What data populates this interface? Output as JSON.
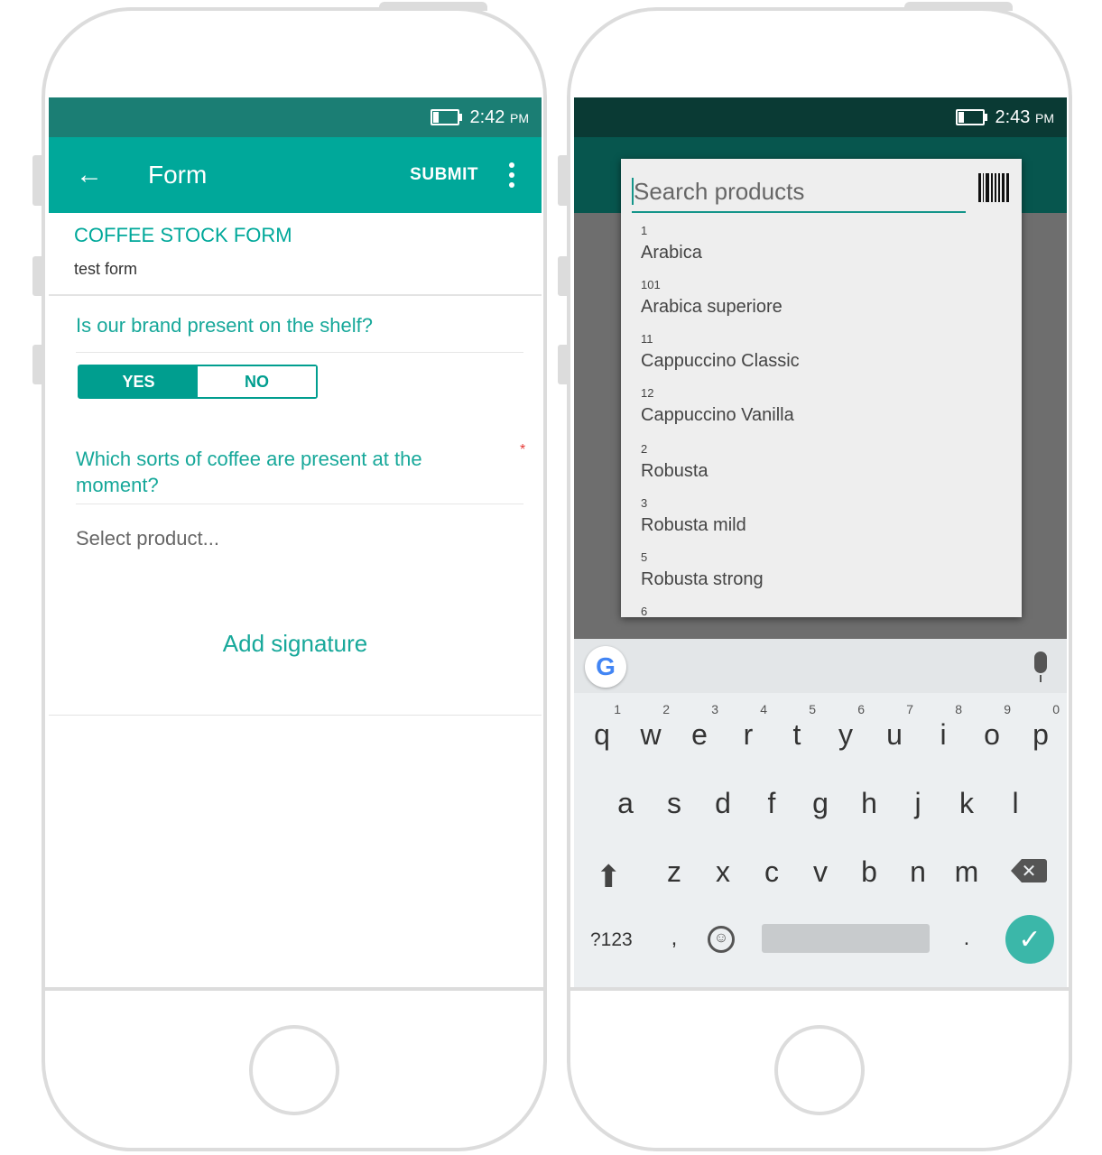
{
  "left": {
    "status": {
      "time": "2:42",
      "ampm": "PM"
    },
    "appbar": {
      "back": "←",
      "title": "Form",
      "submit": "SUBMIT"
    },
    "form": {
      "title": "COFFEE STOCK FORM",
      "subtitle": "test form"
    },
    "question1": {
      "text": "Is our brand present on the shelf?",
      "yes": "YES",
      "no": "NO",
      "selected": "YES"
    },
    "question2": {
      "text": "Which sorts of coffee are present at the moment?",
      "required_mark": "*",
      "placeholder": "Select product..."
    },
    "signature": {
      "label": "Add signature"
    }
  },
  "right": {
    "status": {
      "time": "2:43",
      "ampm": "PM"
    },
    "search": {
      "placeholder": "Search products"
    },
    "products": [
      {
        "code": "1",
        "name": "Arabica"
      },
      {
        "code": "101",
        "name": "Arabica superiore"
      },
      {
        "code": "11",
        "name": "Cappuccino Classic"
      },
      {
        "code": "12",
        "name": "Cappuccino Vanilla"
      },
      {
        "code": "2",
        "name": "Robusta"
      },
      {
        "code": "3",
        "name": "Robusta  mild"
      },
      {
        "code": "5",
        "name": "Robusta strong"
      },
      {
        "code": "6",
        "name": ""
      }
    ],
    "keyboard": {
      "row1": [
        "q",
        "w",
        "e",
        "r",
        "t",
        "y",
        "u",
        "i",
        "o",
        "p"
      ],
      "row1_digits": [
        "1",
        "2",
        "3",
        "4",
        "5",
        "6",
        "7",
        "8",
        "9",
        "0"
      ],
      "row2": [
        "a",
        "s",
        "d",
        "f",
        "g",
        "h",
        "j",
        "k",
        "l"
      ],
      "row3": [
        "z",
        "x",
        "c",
        "v",
        "b",
        "n",
        "m"
      ],
      "symbols": "?123",
      "comma": ",",
      "period": ".",
      "google": "G"
    }
  },
  "colors": {
    "teal": "#00a89a",
    "status_teal": "#1b7e74",
    "dark_status": "#0a3a34",
    "dark_bar": "#07564e"
  }
}
